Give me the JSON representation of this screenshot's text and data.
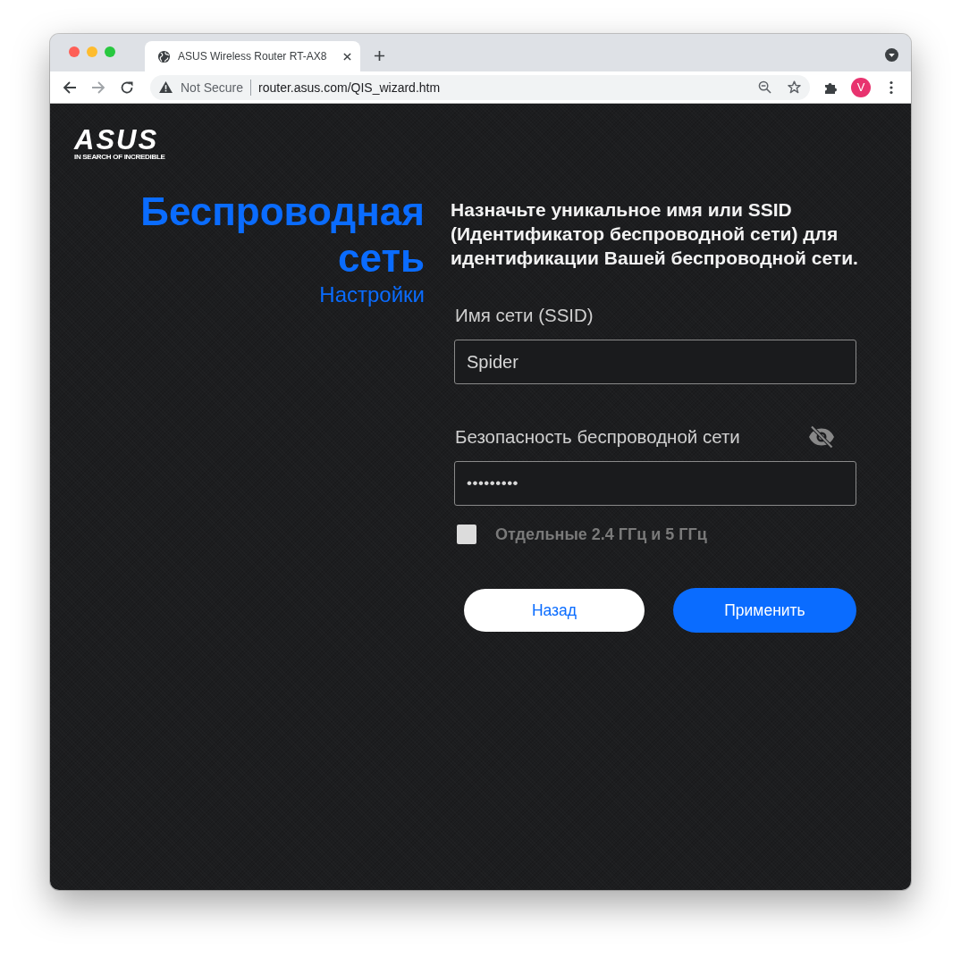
{
  "browser": {
    "tab": {
      "title": "ASUS Wireless Router RT-AX8"
    },
    "security_label": "Not Secure",
    "url": "router.asus.com/QIS_wizard.htm",
    "profile_initial": "V"
  },
  "page": {
    "logo": {
      "wordmark": "ASUS",
      "tagline": "IN SEARCH OF INCREDIBLE"
    },
    "heading": "Беспроводная сеть",
    "subheading": "Настройки",
    "description": "Назначьте уникальное имя или SSID (Идентификатор беспроводной сети) для идентификации Вашей беспроводной сети.",
    "fields": [
      {
        "kind": "text",
        "label": "Имя сети (SSID)",
        "value": "Spider"
      },
      {
        "kind": "password",
        "label": "Безопасность беспроводной сети",
        "value": "•••••••••"
      }
    ],
    "checkbox": {
      "label": "Отдельные 2.4 ГГц и 5 ГГц",
      "checked": false
    },
    "buttons": [
      {
        "kind": "secondary",
        "label": "Назад"
      },
      {
        "kind": "primary",
        "label": "Применить"
      }
    ]
  }
}
